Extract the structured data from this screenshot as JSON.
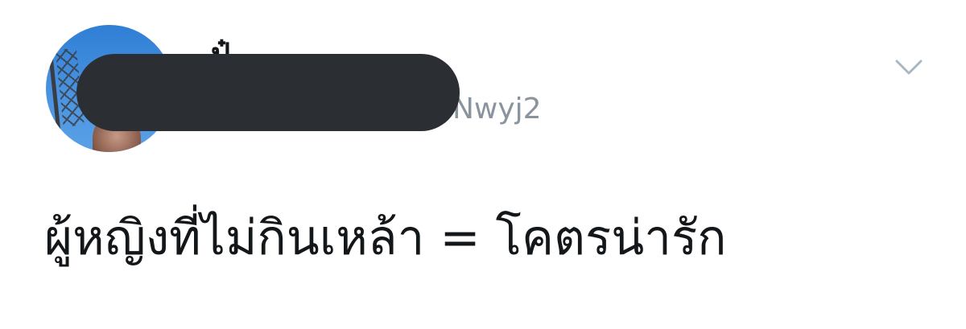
{
  "tweet": {
    "author": {
      "display_name": "ป๋",
      "handle_visible": "Nwyj2"
    },
    "text": "ผู้หญิงที่ไม่กินเหล้า = โคตรน่ารัก",
    "menu_icon": "chevron-down-icon"
  },
  "colors": {
    "text_primary": "#14171a",
    "text_secondary": "#8a949e",
    "redaction": "#2b2e33",
    "chevron": "#aab8c2"
  }
}
